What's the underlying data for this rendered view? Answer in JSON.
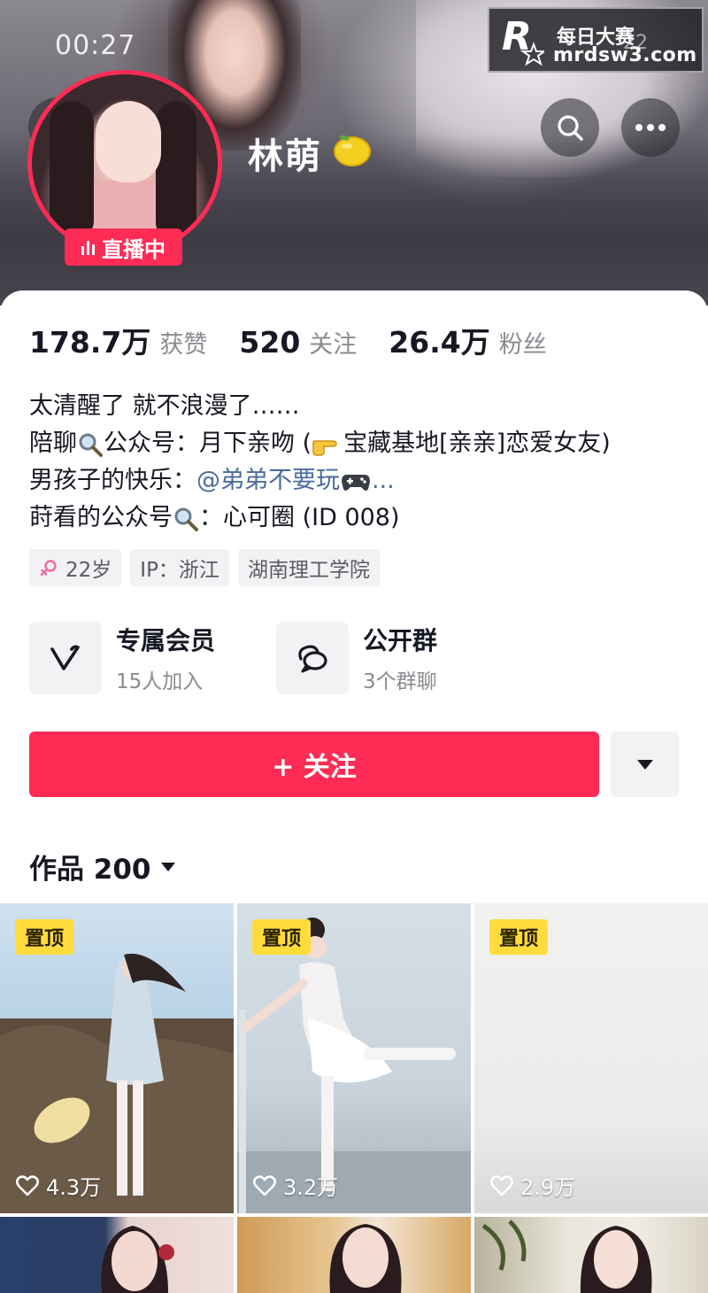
{
  "status": {
    "time": "00:27"
  },
  "watermark": {
    "brand_cn": "每日大赛",
    "url": "mrdsw3.com",
    "partial_number": "22"
  },
  "profile": {
    "nickname": "林萌",
    "live_label": "直播中",
    "verified_emoji_icon": "lemon-icon"
  },
  "stats": [
    {
      "value": "178.7万",
      "label": "获赞"
    },
    {
      "value": "520",
      "label": "关注"
    },
    {
      "value": "26.4万",
      "label": "粉丝"
    }
  ],
  "bio": {
    "line1": "太清醒了 就不浪漫了……",
    "line2_a": "陪聊",
    "line2_b": "公众号：月下亲吻 (",
    "line2_c": "宝藏基地[亲亲]恋爱女友)",
    "line3_a": "男孩子的快乐：",
    "line3_mention": "@弟弟不要玩",
    "line3_ellipsis": "...",
    "line4_a": "莳看的公众号",
    "line4_b": "：心可圈 (ID 008)"
  },
  "tags": [
    {
      "label": "22岁",
      "icon": "female-icon"
    },
    {
      "label": "IP：浙江"
    },
    {
      "label": "湖南理工学院"
    }
  ],
  "features": [
    {
      "title": "专属会员",
      "subtitle": "15人加入",
      "icon": "vip-v-icon"
    },
    {
      "title": "公开群",
      "subtitle": "3个群聊",
      "icon": "group-chat-icon"
    }
  ],
  "actions": {
    "follow_label": "+ 关注"
  },
  "works": {
    "label": "作品 200"
  },
  "grid": [
    {
      "pinned_label": "置顶",
      "likes": "4.3万"
    },
    {
      "pinned_label": "置顶",
      "likes": "3.2万"
    },
    {
      "pinned_label": "置顶",
      "likes": "2.9万"
    }
  ],
  "colors": {
    "accent": "#fe2c55",
    "pin": "#ffdc3b",
    "mention": "#4a6b9c"
  }
}
